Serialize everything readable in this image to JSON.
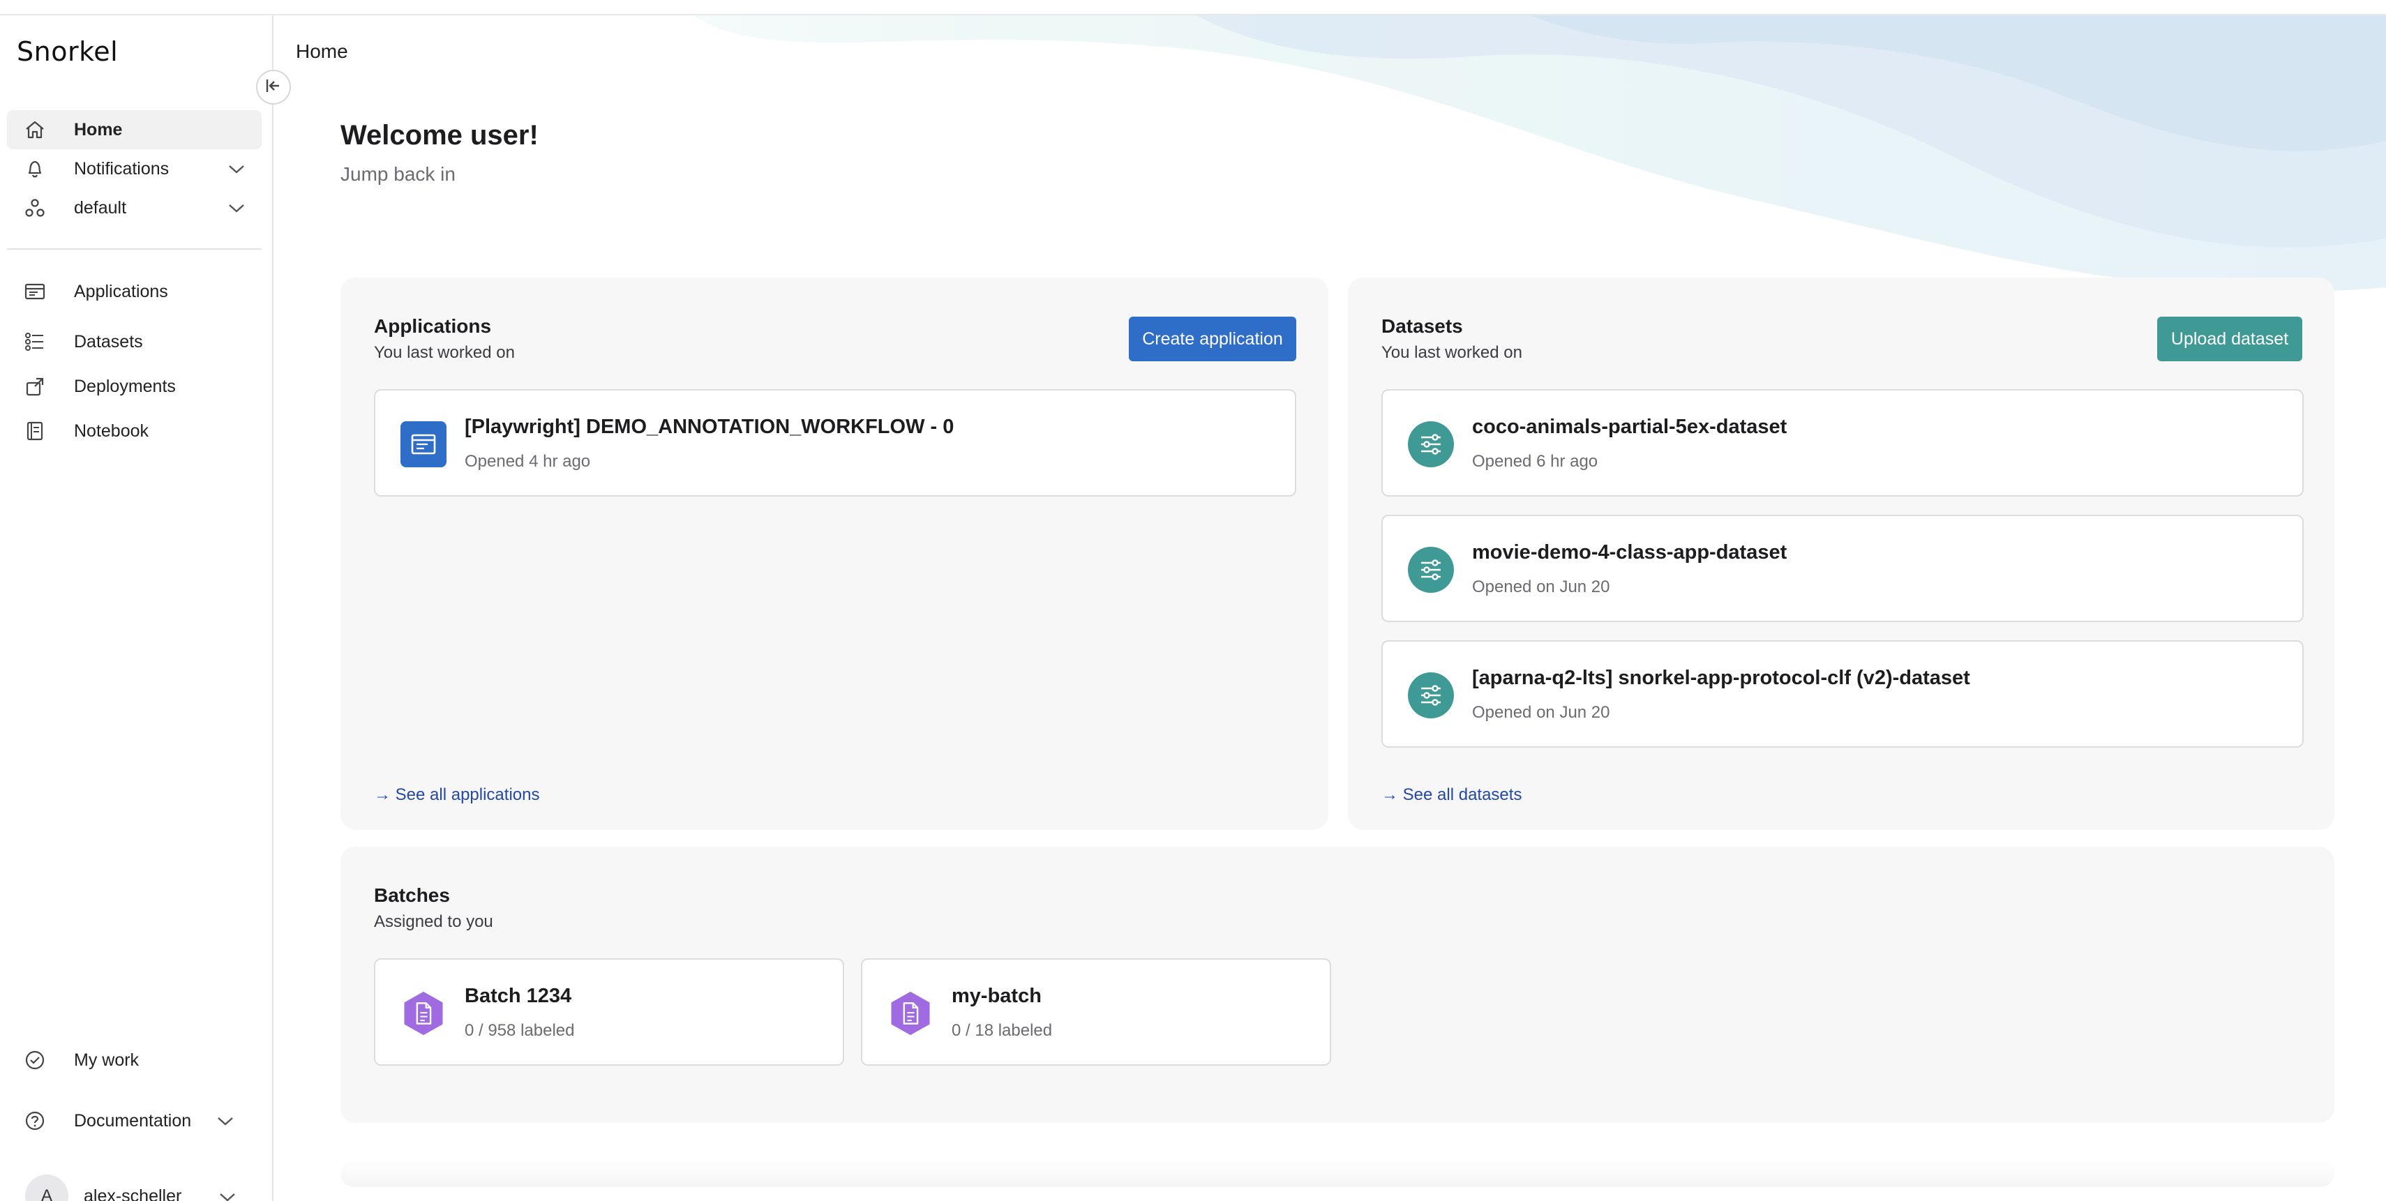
{
  "sidebar": {
    "logo": "Snorkel",
    "items": [
      {
        "label": "Home"
      },
      {
        "label": "Notifications"
      },
      {
        "label": "default"
      },
      {
        "label": "Applications"
      },
      {
        "label": "Datasets"
      },
      {
        "label": "Deployments"
      },
      {
        "label": "Notebook"
      }
    ],
    "bottom": [
      {
        "label": "My work"
      },
      {
        "label": "Documentation"
      }
    ],
    "user": {
      "initial": "A",
      "name": "alex-scheller"
    }
  },
  "header": {
    "breadcrumb": "Home"
  },
  "welcome": {
    "title": "Welcome user!",
    "subtitle": "Jump back in"
  },
  "applications": {
    "title": "Applications",
    "subtitle": "You last worked on",
    "create_label": "Create application",
    "items": [
      {
        "name": "[Playwright] DEMO_ANNOTATION_WORKFLOW - 0",
        "meta": "Opened 4 hr ago"
      }
    ],
    "see_all": "→ See all applications"
  },
  "datasets": {
    "title": "Datasets",
    "subtitle": "You last worked on",
    "upload_label": "Upload dataset",
    "items": [
      {
        "name": "coco-animals-partial-5ex-dataset",
        "meta": "Opened 6 hr ago"
      },
      {
        "name": "movie-demo-4-class-app-dataset",
        "meta": "Opened on Jun 20"
      },
      {
        "name": "[aparna-q2-lts] snorkel-app-protocol-clf (v2)-dataset",
        "meta": "Opened on Jun 20"
      }
    ],
    "see_all": "→ See all datasets"
  },
  "batches": {
    "title": "Batches",
    "subtitle": "Assigned to you",
    "items": [
      {
        "name": "Batch 1234",
        "meta": "0 / 958 labeled"
      },
      {
        "name": "my-batch",
        "meta": "0 / 18 labeled"
      }
    ]
  },
  "colors": {
    "primary_blue": "#2f6ec8",
    "teal": "#3f9a96",
    "purple": "#a06be0",
    "link": "#2348a8"
  }
}
